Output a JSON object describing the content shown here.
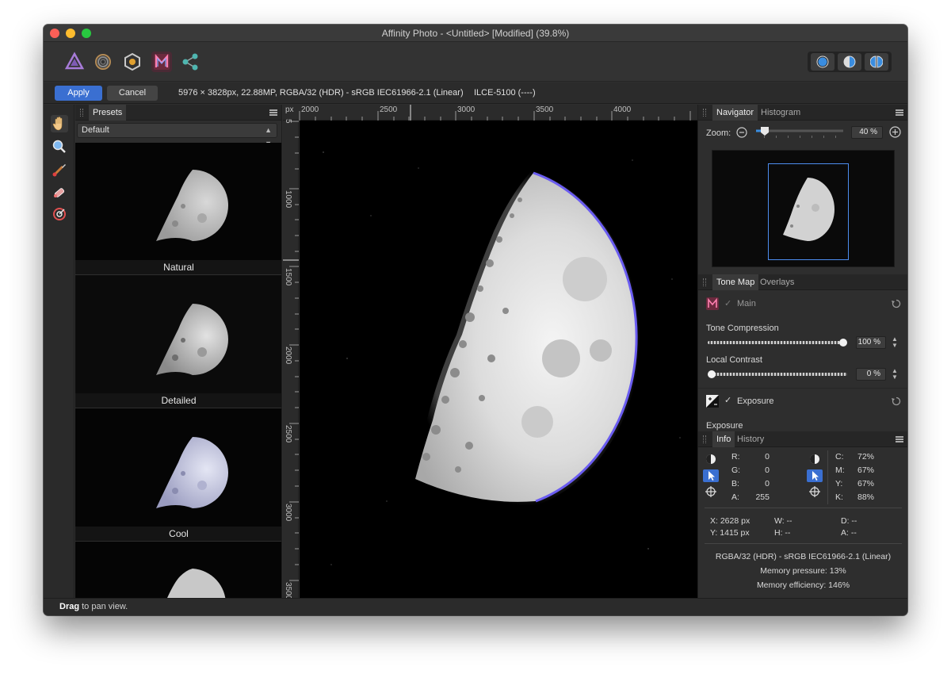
{
  "window": {
    "title": "Affinity Photo - <Untitled> [Modified] (39.8%)"
  },
  "personas": [
    "photo-persona-icon",
    "liquify-persona-icon",
    "develop-persona-icon",
    "tone-mapping-persona-icon",
    "export-persona-icon"
  ],
  "context": {
    "apply_label": "Apply",
    "cancel_label": "Cancel",
    "doc_info": "5976 × 3828px, 22.88MP, RGBA/32 (HDR) - sRGB IEC61966-2.1 (Linear)",
    "camera": "ILCE-5100 (----)"
  },
  "presets_panel": {
    "tab": "Presets",
    "category": "Default",
    "items": [
      {
        "label": "Natural"
      },
      {
        "label": "Detailed"
      },
      {
        "label": "Cool"
      },
      {
        "label": ""
      }
    ]
  },
  "rulers": {
    "unit": "px",
    "top_ticks": [
      "2000",
      "2500",
      "3000",
      "3500",
      "4000"
    ],
    "left_ticks": [
      "5",
      "1000",
      "1500",
      "2000",
      "2500",
      "3000",
      "3500"
    ]
  },
  "navigator": {
    "tabs": [
      "Navigator",
      "Histogram"
    ],
    "zoom_label": "Zoom:",
    "zoom_value": "40 %",
    "zoom_fraction": 0.1
  },
  "tonemap": {
    "tabs": [
      "Tone Map",
      "Overlays"
    ],
    "main_label": "Main",
    "tone_compression_label": "Tone Compression",
    "tone_compression_value": "100 %",
    "tone_compression_fraction": 1.0,
    "local_contrast_label": "Local Contrast",
    "local_contrast_value": "0 %",
    "local_contrast_fraction": 0.0,
    "exposure_group_label": "Exposure",
    "exposure_label": "Exposure"
  },
  "info": {
    "tabs": [
      "Info",
      "History"
    ],
    "rgba": [
      {
        "label": "R:",
        "value": "0"
      },
      {
        "label": "G:",
        "value": "0"
      },
      {
        "label": "B:",
        "value": "0"
      },
      {
        "label": "A:",
        "value": "255"
      }
    ],
    "cmyk": [
      {
        "label": "C:",
        "value": "72%"
      },
      {
        "label": "M:",
        "value": "67%"
      },
      {
        "label": "Y:",
        "value": "67%"
      },
      {
        "label": "K:",
        "value": "88%"
      }
    ],
    "x": "X: 2628 px",
    "y": "Y: 1415 px",
    "w": "W: --",
    "h": "H: --",
    "d": "D: --",
    "a": "A: --",
    "color_profile": "RGBA/32 (HDR) - sRGB IEC61966-2.1 (Linear)",
    "memory_pressure": "Memory pressure: 13%",
    "memory_efficiency": "Memory efficiency: 146%"
  },
  "status": {
    "bold": "Drag",
    "text": " to pan view."
  },
  "colors": {
    "accent": "#3a6fd1",
    "panel": "#2e2e2e",
    "canvas": "#000000"
  }
}
